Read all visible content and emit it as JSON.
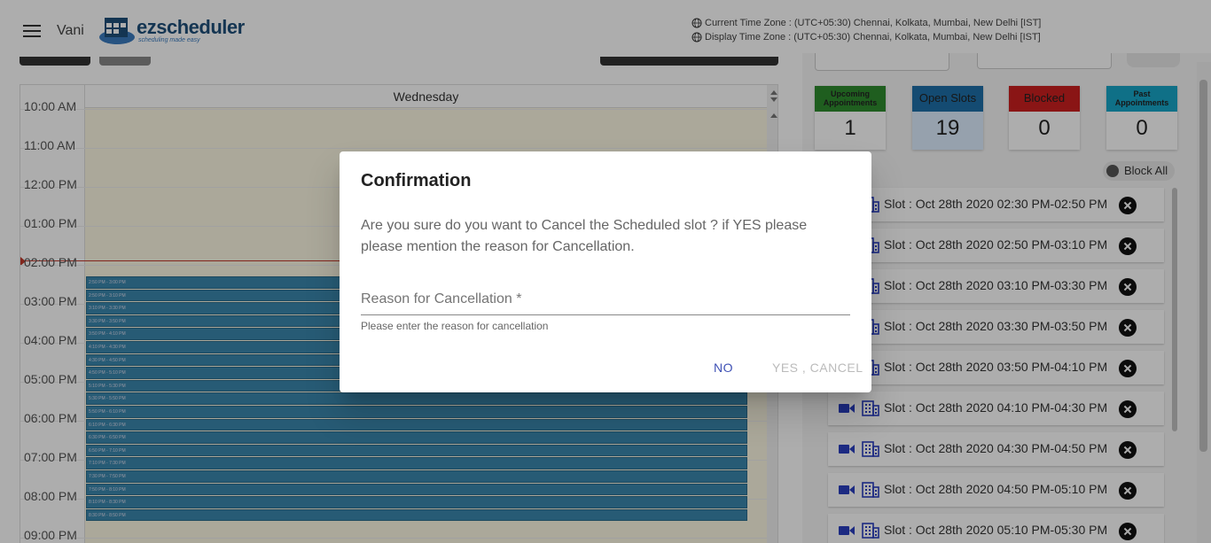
{
  "header": {
    "user_name": "Vani",
    "logo_text": "ezscheduler",
    "logo_tagline": "scheduling made easy",
    "current_tz": "Current Time Zone : (UTC+05:30) Chennai, Kolkata, Mumbai, New Delhi [IST]",
    "display_tz": "Display Time Zone : (UTC+05:30) Chennai, Kolkata, Mumbai, New Delhi [IST]"
  },
  "calendar": {
    "day_header": "Wednesday",
    "time_labels": [
      "10:00 AM",
      "11:00 AM",
      "12:00 PM",
      "01:00 PM",
      "02:00 PM",
      "03:00 PM",
      "04:00 PM",
      "05:00 PM",
      "06:00 PM",
      "07:00 PM",
      "08:00 PM",
      "09:00 PM"
    ],
    "events": [
      "2:50 PM - 3:00 PM",
      "2:50 PM - 3:10 PM",
      "3:10 PM - 3:30 PM",
      "3:30 PM - 3:50 PM",
      "3:50 PM - 4:10 PM",
      "4:10 PM - 4:30 PM",
      "4:30 PM - 4:50 PM",
      "4:50 PM - 5:10 PM",
      "5:10 PM - 5:30 PM",
      "5:30 PM - 5:50 PM",
      "5:50 PM - 6:10 PM",
      "6:10 PM - 6:30 PM",
      "6:30 PM - 6:50 PM",
      "6:50 PM - 7:10 PM",
      "7:10 PM - 7:30 PM",
      "7:30 PM - 7:50 PM",
      "7:50 PM - 8:10 PM",
      "8:10 PM - 8:30 PM",
      "8:30 PM - 8:50 PM"
    ]
  },
  "stats": {
    "upcoming_label": "Upcoming Appointments",
    "upcoming_value": "1",
    "upcoming_color": "#2e8b2e",
    "open_label": "Open Slots",
    "open_value": "19",
    "open_color": "#1e6fa8",
    "blocked_label": "Blocked",
    "blocked_value": "0",
    "blocked_color": "#cc1f1f",
    "past_label": "Past Appointments",
    "past_value": "0",
    "past_color": "#17a5c8"
  },
  "slots_panel": {
    "title_partial": "ots",
    "block_all": "Block All",
    "slots": [
      "Slot : Oct 28th 2020 02:30 PM-02:50 PM",
      "Slot : Oct 28th 2020 02:50 PM-03:10 PM",
      "Slot : Oct 28th 2020 03:10 PM-03:30 PM",
      "Slot : Oct 28th 2020 03:30 PM-03:50 PM",
      "Slot : Oct 28th 2020 03:50 PM-04:10 PM",
      "Slot : Oct 28th 2020 04:10 PM-04:30 PM",
      "Slot : Oct 28th 2020 04:30 PM-04:50 PM",
      "Slot : Oct 28th 2020 04:50 PM-05:10 PM",
      "Slot : Oct 28th 2020 05:10 PM-05:30 PM"
    ]
  },
  "dialog": {
    "title": "Confirmation",
    "message": "Are you sure do you want to Cancel the Scheduled slot ? if YES please please mention the reason for Cancellation.",
    "reason_placeholder": "Reason for Cancellation *",
    "hint": "Please enter the reason for cancellation",
    "no_label": "NO",
    "yes_label": "YES , CANCEL"
  }
}
